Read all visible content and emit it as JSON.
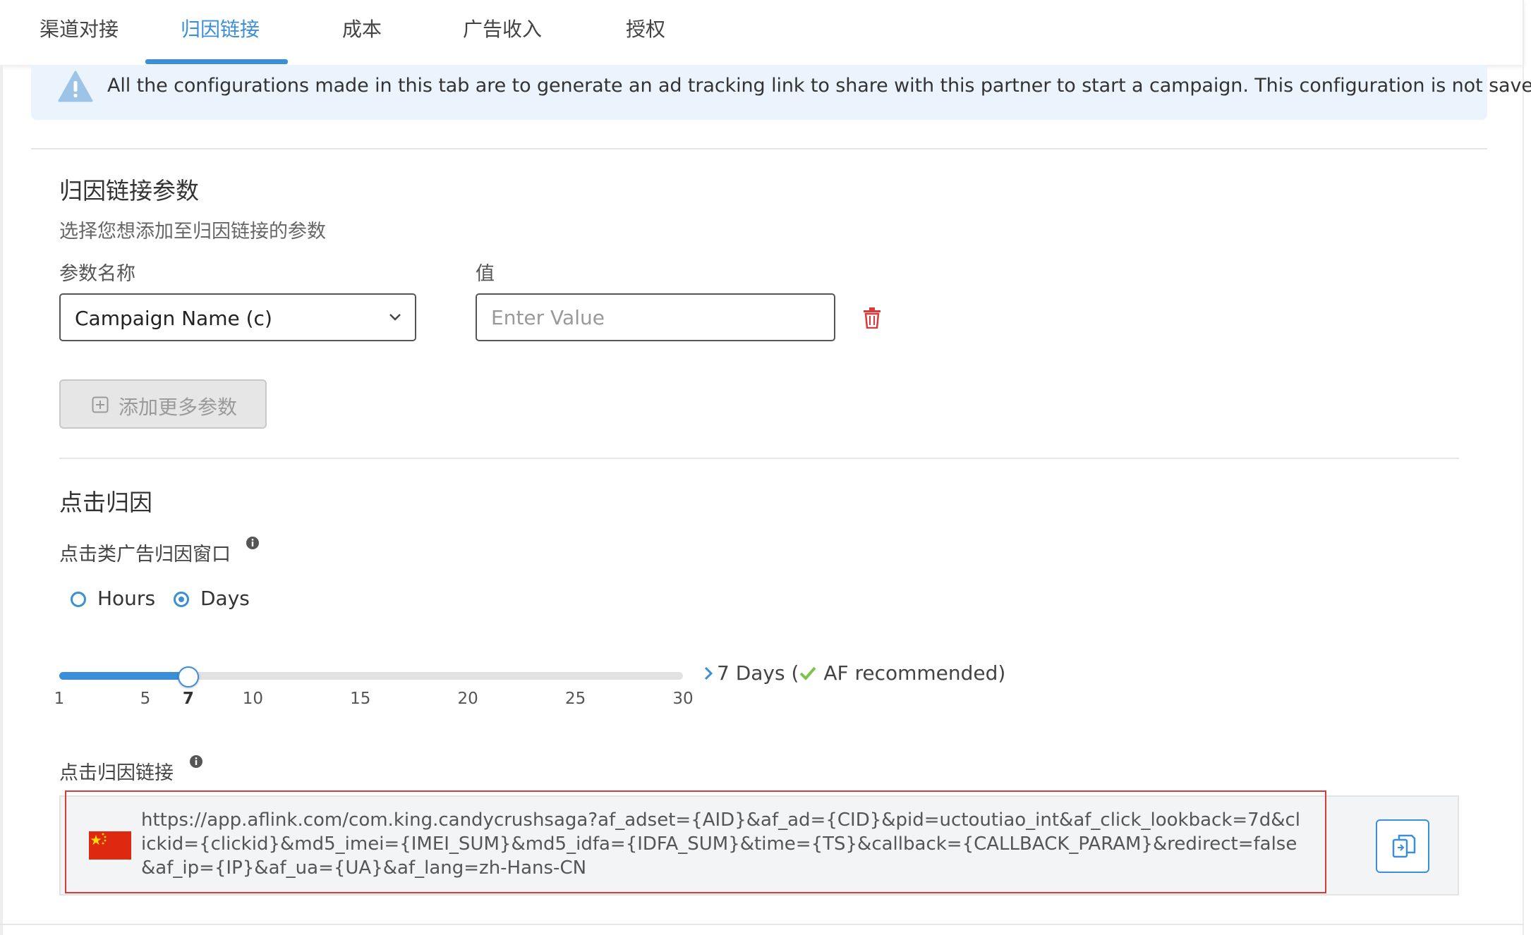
{
  "tabs": [
    {
      "label": "渠道对接",
      "active": false
    },
    {
      "label": "归因链接",
      "active": true
    },
    {
      "label": "成本",
      "active": false
    },
    {
      "label": "广告收入",
      "active": false
    },
    {
      "label": "授权",
      "active": false
    }
  ],
  "banner": {
    "icon": "warning-icon",
    "text": "All the configurations made in this tab are to generate an ad tracking link to share with this partner to start a campaign. This configuration is not saved."
  },
  "params": {
    "title": "归因链接参数",
    "subtitle": "选择您想添加至归因链接的参数",
    "name_label": "参数名称",
    "value_label": "值",
    "selected_param": "Campaign Name (c)",
    "value_placeholder": "Enter Value",
    "value": "",
    "add_button": "添加更多参数"
  },
  "click": {
    "title": "点击归因",
    "window_label": "点击类广告归因窗口",
    "radio": [
      {
        "label": "Hours",
        "checked": false
      },
      {
        "label": "Days",
        "checked": true
      }
    ],
    "slider": {
      "min": 1,
      "max": 30,
      "value": 7,
      "ticks": [
        "1",
        "5",
        "7",
        "10",
        "15",
        "20",
        "25",
        "30"
      ]
    },
    "recommendation": {
      "value_text": "7 Days (",
      "note": " AF recommended)"
    },
    "link_label": "点击归因链接",
    "link": "https://app.aflink.com/com.king.candycrushsaga?af_adset={AID}&af_ad={CID}&pid=uctoutiao_int&af_click_lookback=7d&clickid={clickid}&md5_imei={IMEI_SUM}&md5_idfa={IDFA_SUM}&time={TS}&callback={CALLBACK_PARAM}&redirect=false&af_ip={IP}&af_ua={UA}&af_lang=zh-Hans-CN"
  },
  "colors": {
    "accent": "#3b8fd6",
    "danger": "#d93a3a",
    "success": "#7cc34a",
    "banner_bg": "#ebf4fc"
  }
}
